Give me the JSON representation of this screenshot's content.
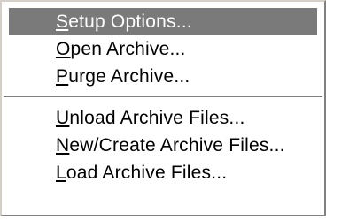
{
  "menu": {
    "group1": [
      {
        "accel": "S",
        "rest": "etup Options...",
        "selected": true
      },
      {
        "accel": "O",
        "rest": "pen Archive...",
        "selected": false
      },
      {
        "accel": "P",
        "rest": "urge Archive...",
        "selected": false
      }
    ],
    "group2": [
      {
        "accel": "U",
        "rest": "nload Archive Files...",
        "selected": false
      },
      {
        "accel": "N",
        "rest": "ew/Create Archive Files...",
        "selected": false
      },
      {
        "accel": "L",
        "rest": "oad Archive Files...",
        "selected": false
      }
    ]
  },
  "colors": {
    "highlight": "#7a7a7a",
    "highlight_text": "#ffffff",
    "menu_background": "#ffffff"
  }
}
